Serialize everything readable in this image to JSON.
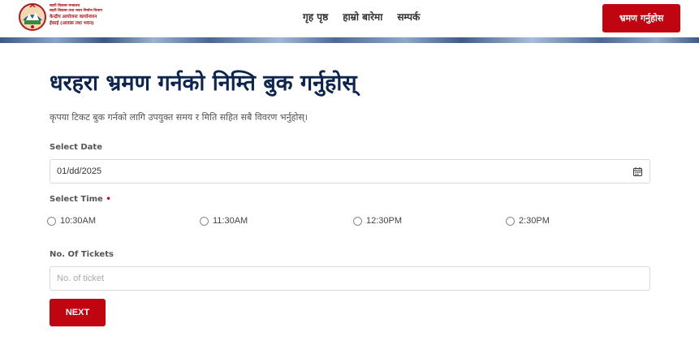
{
  "header": {
    "logo": {
      "line1": "सहरी विकास मन्त्रालय",
      "line2": "सहरी विकास तथा भवन निर्माण विभाग",
      "line3": "केन्द्रीय आयोजना कार्यान्वयन",
      "line4": "ईकाई (आवास तथा भवन)"
    },
    "nav": {
      "home": "गृह पृष्ठ",
      "about": "हाम्रो बारेमा",
      "contact": "सम्पर्क"
    },
    "book_button": "भ्रमण गर्नुहोस"
  },
  "main": {
    "title": "धरहरा भ्रमण गर्नको निम्ति बुक गर्नुहोस्",
    "subtitle": "कृपया टिकट बुक गर्नको लागि उपयुक्त समय र मिति सहित सबै विवरण भर्नुहोस्।",
    "date": {
      "label": "Select Date",
      "value": "01/dd/2025"
    },
    "time": {
      "label": "Select Time",
      "required_mark": "•",
      "options": [
        "10:30AM",
        "11:30AM",
        "12:30PM",
        "2:30PM"
      ]
    },
    "tickets": {
      "label": "No. Of Tickets",
      "placeholder": "No. of ticket"
    },
    "next_button": "NEXT"
  },
  "colors": {
    "accent": "#c00510",
    "title": "#0c2550"
  },
  "icons": [
    "nepal-emblem-icon",
    "calendar-icon",
    "radio-icon"
  ]
}
